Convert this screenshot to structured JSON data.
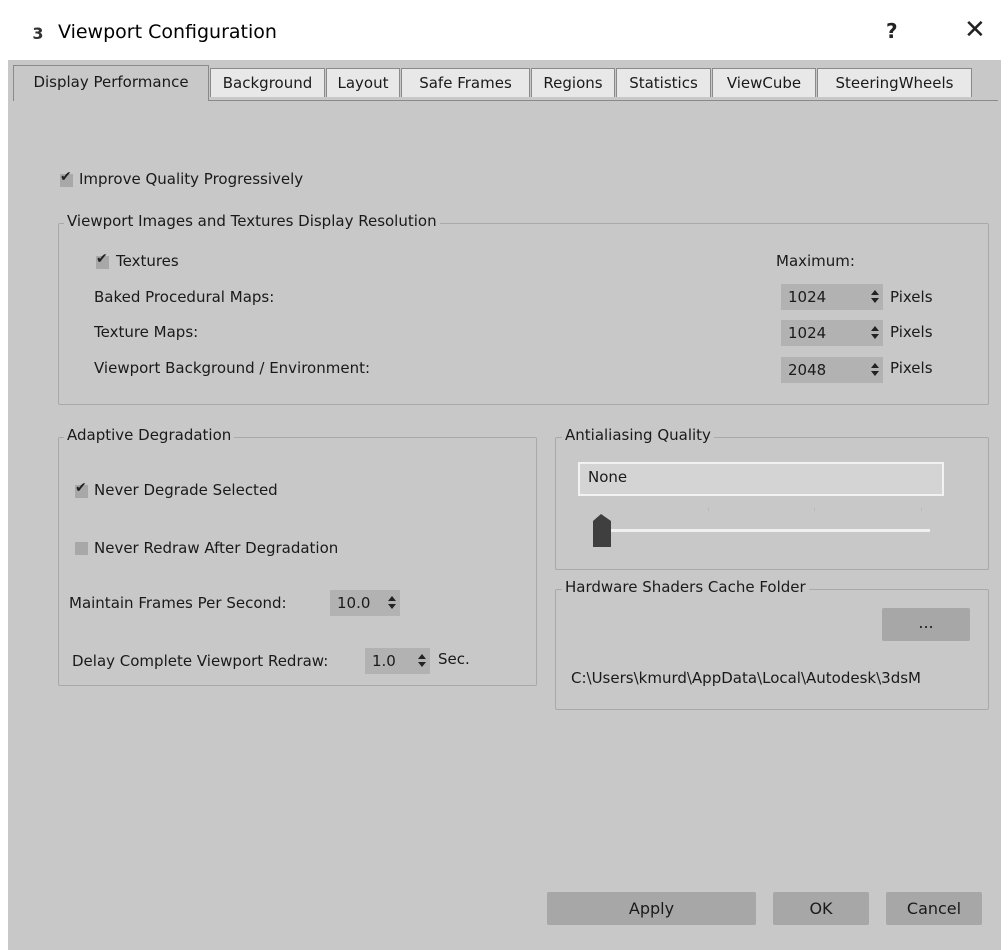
{
  "window": {
    "title": "Viewport Configuration",
    "app_icon_text": "3",
    "help_label": "?",
    "close_label": "✕"
  },
  "tabs": [
    {
      "label": "Display Performance",
      "active": true
    },
    {
      "label": "Background",
      "active": false
    },
    {
      "label": "Layout",
      "active": false
    },
    {
      "label": "Safe Frames",
      "active": false
    },
    {
      "label": "Regions",
      "active": false
    },
    {
      "label": "Statistics",
      "active": false
    },
    {
      "label": "ViewCube",
      "active": false
    },
    {
      "label": "SteeringWheels",
      "active": false
    }
  ],
  "improve_quality": {
    "label": "Improve Quality Progressively",
    "checked": true
  },
  "resolution_group": {
    "title": "Viewport Images and Textures Display Resolution",
    "textures": {
      "label": "Textures",
      "checked": true
    },
    "maximum_label": "Maximum:",
    "rows": [
      {
        "label": "Baked Procedural Maps:",
        "value": "1024",
        "unit": "Pixels"
      },
      {
        "label": "Texture Maps:",
        "value": "1024",
        "unit": "Pixels"
      },
      {
        "label": "Viewport Background / Environment:",
        "value": "2048",
        "unit": "Pixels"
      }
    ]
  },
  "adaptive_group": {
    "title": "Adaptive Degradation",
    "never_degrade": {
      "label": "Never Degrade Selected",
      "checked": true
    },
    "never_redraw": {
      "label": "Never Redraw After Degradation",
      "checked": false
    },
    "fps": {
      "label": "Maintain Frames Per Second:",
      "value": "10.0"
    },
    "delay": {
      "label": "Delay Complete Viewport Redraw:",
      "value": "1.0",
      "unit": "Sec."
    }
  },
  "antialiasing_group": {
    "title": "Antialiasing Quality",
    "value": "None",
    "slider_position": 0
  },
  "shader_cache_group": {
    "title": "Hardware Shaders Cache Folder",
    "browse_label": "...",
    "path": "C:\\Users\\kmurd\\AppData\\Local\\Autodesk\\3dsM"
  },
  "footer": {
    "apply_label": "Apply",
    "ok_label": "OK",
    "cancel_label": "Cancel"
  },
  "colors": {
    "dialog_bg": "#c8c8c8",
    "titlebar_bg": "#ffffff",
    "control_bg": "#b2b2b2",
    "button_bg": "#a7a7a7"
  }
}
